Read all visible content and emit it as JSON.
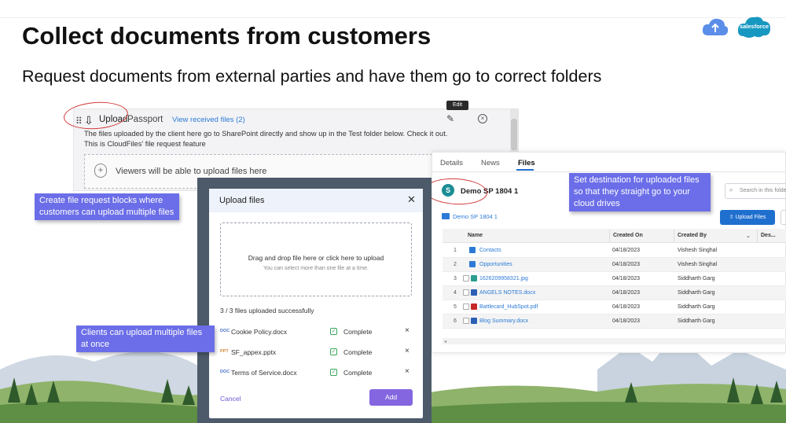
{
  "slide": {
    "title": "Collect documents from customers",
    "subtitle": "Request documents from external parties and have them go to correct folders",
    "logo_text": "salesforce",
    "colors": {
      "callout": "#6b6ee8",
      "annotation": "#d23b3b",
      "accent": "#8466e0",
      "link": "#2d7ad6"
    }
  },
  "upload_block": {
    "label": "Upload",
    "name": "Passport",
    "view_link": "View received files (2)",
    "tooltip": "Edit",
    "description": "The files uploaded by the client here go to SharePoint directly and show up in the Test folder below. Check it out. This is CloudFiles' file request feature",
    "viewers_text": "Viewers will be able to upload files here"
  },
  "modal": {
    "title": "Upload files",
    "drop_text": "Drag and drop file here or click here to upload",
    "drop_hint": "You can select more than one file at a time.",
    "count": "3 / 3 files uploaded successfully",
    "files": [
      {
        "type": "DOC",
        "name": "Cookie Policy.docx",
        "status": "Complete"
      },
      {
        "type": "PPT",
        "name": "SF_appex.pptx",
        "status": "Complete"
      },
      {
        "type": "DOC",
        "name": "Terms of Service.docx",
        "status": "Complete"
      }
    ],
    "cancel": "Cancel",
    "add": "Add"
  },
  "callouts": {
    "blocks": "Create file request blocks where customers can upload multiple files",
    "multiple": "Clients can upload multiple files at once",
    "destination": "Set destination for uploaded files so that they straight go to your cloud drives"
  },
  "sharepoint": {
    "tabs": [
      "Details",
      "News",
      "Files"
    ],
    "active_tab": "Files",
    "site_name": "Demo SP 1804 1",
    "search_placeholder": "Search in this folder",
    "breadcrumb": "Demo SP 1804 1",
    "upload_button": "Upload Files",
    "columns": [
      "Name",
      "Created On",
      "Created By",
      "Des..."
    ],
    "rows": [
      {
        "n": "1",
        "name": "Contacts",
        "kind": "folder",
        "date": "04/18/2023",
        "by": "Vishesh Singhal"
      },
      {
        "n": "2",
        "name": "Opportunities",
        "kind": "folder",
        "date": "04/18/2023",
        "by": "Vishesh Singhal"
      },
      {
        "n": "3",
        "name": "1626209958321.jpg",
        "kind": "image",
        "date": "04/18/2023",
        "by": "Siddharth Garg"
      },
      {
        "n": "4",
        "name": "ANGELS NOTES.docx",
        "kind": "doc",
        "date": "04/18/2023",
        "by": "Siddharth Garg"
      },
      {
        "n": "5",
        "name": "Battlecard_HubSpot.pdf",
        "kind": "pdf",
        "date": "04/18/2023",
        "by": "Siddharth Garg"
      },
      {
        "n": "6",
        "name": "Blog Summary.docx",
        "kind": "doc",
        "date": "04/18/2023",
        "by": "Siddharth Garg"
      }
    ]
  }
}
